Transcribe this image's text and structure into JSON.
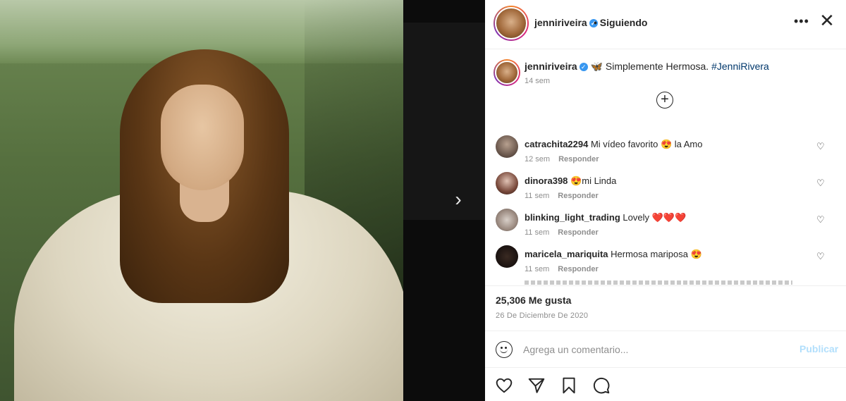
{
  "header": {
    "username": "jenniriveira",
    "following_label": "• Siguiendo",
    "more_label": "•••",
    "close_label": "✕"
  },
  "caption": {
    "username": "jenniriveira",
    "emoji": "🦋",
    "text": "Simplemente Hermosa.",
    "hashtag": "#JenniRivera",
    "time": "14 sem"
  },
  "load_more_label": "+",
  "comments": [
    {
      "username": "catrachita2294",
      "text": "Mi vídeo favorito 😍 la Amo",
      "time": "12 sem",
      "reply": "Responder"
    },
    {
      "username": "dinora398",
      "text": "😍mi Linda",
      "time": "11 sem",
      "reply": "Responder"
    },
    {
      "username": "blinking_light_trading",
      "text": "Lovely ❤️❤️❤️",
      "time": "11 sem",
      "reply": "Responder"
    },
    {
      "username": "maricela_mariquita",
      "text": "Hermosa mariposa 😍",
      "time": "11 sem",
      "reply": "Responder"
    }
  ],
  "stats": {
    "likes": "25,306 Me gusta",
    "date": "26 De Diciembre De 2020"
  },
  "composer": {
    "placeholder": "Agrega un comentario...",
    "publish_label": "Publicar"
  },
  "nav": {
    "next_label": "›"
  },
  "colors": {
    "accent": "#0095f6",
    "publish_disabled": "#b2dffc",
    "verified": "#3897f0"
  }
}
